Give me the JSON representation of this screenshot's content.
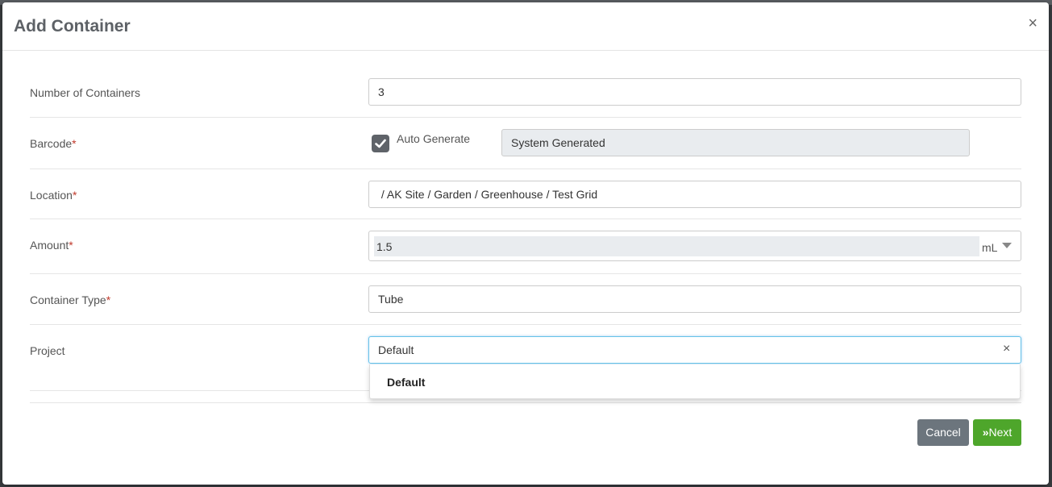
{
  "modal": {
    "title": "Add Container",
    "close": "×"
  },
  "fields": {
    "num_containers": {
      "label": "Number of Containers",
      "value": "3"
    },
    "barcode": {
      "label": "Barcode",
      "required_mark": "*",
      "auto_generate_label": "Auto Generate",
      "auto_generate_checked": true,
      "value": "System Generated"
    },
    "location": {
      "label": "Location",
      "required_mark": "*",
      "value": " / AK Site / Garden / Greenhouse / Test Grid"
    },
    "amount": {
      "label": "Amount",
      "required_mark": "*",
      "value": "1.5",
      "unit": "mL"
    },
    "container_type": {
      "label": "Container Type",
      "required_mark": "*",
      "value": "Tube"
    },
    "project": {
      "label": "Project",
      "value": "Default",
      "clear": "×",
      "options": [
        "Default"
      ]
    }
  },
  "buttons": {
    "cancel": "Cancel",
    "next_icon": "»",
    "next": "Next"
  },
  "colors": {
    "next_button": "#4ea62b",
    "cancel_button": "#6c757d",
    "required": "#c0392b",
    "focus_border": "#66c2e8"
  }
}
